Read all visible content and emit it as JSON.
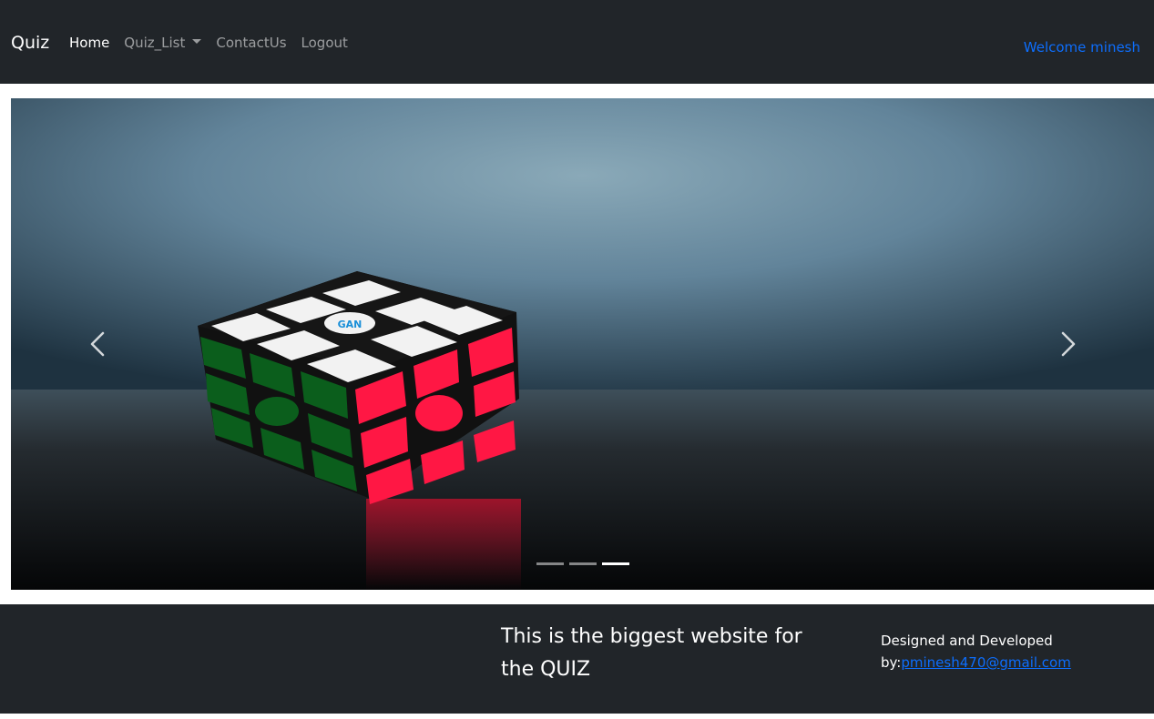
{
  "navbar": {
    "brand": "Quiz",
    "links": [
      {
        "label": "Home",
        "active": true
      },
      {
        "label": "Quiz_List",
        "dropdown": true
      },
      {
        "label": "ContactUs"
      },
      {
        "label": "Logout"
      }
    ],
    "welcome": "Welcome minesh"
  },
  "carousel": {
    "prev_icon": "chevron-left-icon",
    "next_icon": "chevron-right-icon",
    "slide_count": 3,
    "active_slide": 3
  },
  "footer": {
    "tagline": "This is the biggest website for the QUIZ",
    "credit_prefix": "Designed and Developed by:",
    "email": "pminesh470@gmail.com"
  },
  "colors": {
    "navbar_bg": "#212529",
    "link_blue": "#0d6efd"
  }
}
